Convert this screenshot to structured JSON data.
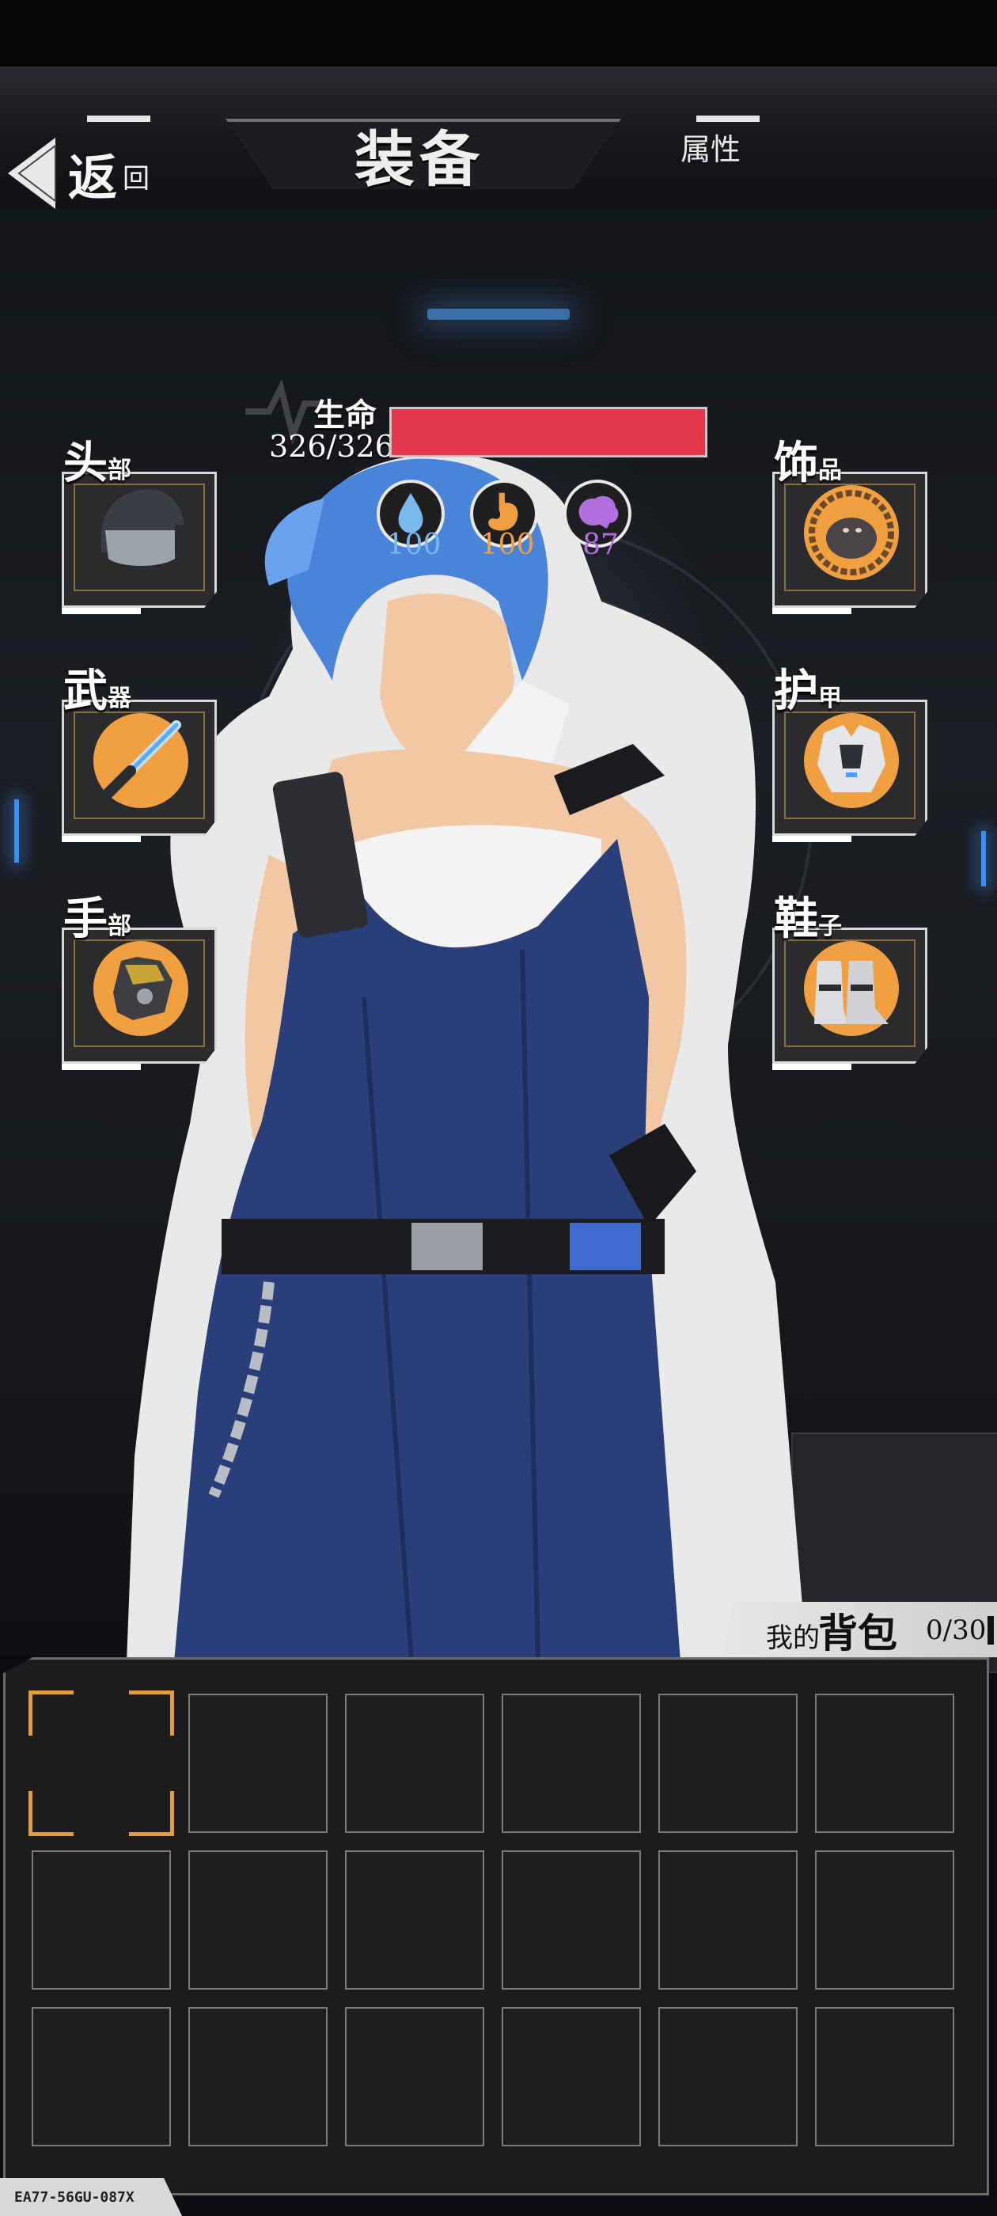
{
  "header": {
    "back_big": "返",
    "back_small": "回",
    "title": "装备",
    "attr_tab": "属性"
  },
  "hp": {
    "label": "生命",
    "value": "326/326",
    "current": 326,
    "max": 326,
    "color": "#e2364a"
  },
  "stats": [
    {
      "icon": "water-drop-icon",
      "value": "100",
      "color": "#7ab8f0"
    },
    {
      "icon": "stomach-icon",
      "value": "100",
      "color": "#f0a040"
    },
    {
      "icon": "brain-icon",
      "value": "87",
      "color": "#b070e0"
    }
  ],
  "slots_left": [
    {
      "big": "头",
      "small": "部",
      "item_icon": "helmet-icon"
    },
    {
      "big": "武",
      "small": "器",
      "item_icon": "lightsaber-icon"
    },
    {
      "big": "手",
      "small": "部",
      "item_icon": "gauntlet-icon"
    }
  ],
  "slots_right": [
    {
      "big": "饰",
      "small": "品",
      "item_icon": "mole-charm-icon"
    },
    {
      "big": "护",
      "small": "甲",
      "item_icon": "armor-icon"
    },
    {
      "big": "鞋",
      "small": "子",
      "item_icon": "boots-icon"
    }
  ],
  "backpack": {
    "title_small": "我的",
    "title_big": "背包",
    "count": "0/30",
    "visible_cells": 18
  },
  "footer": {
    "code": "EA77-56GU-087X"
  },
  "colors": {
    "accent": "#e0a040",
    "background": "#0c0d10"
  }
}
